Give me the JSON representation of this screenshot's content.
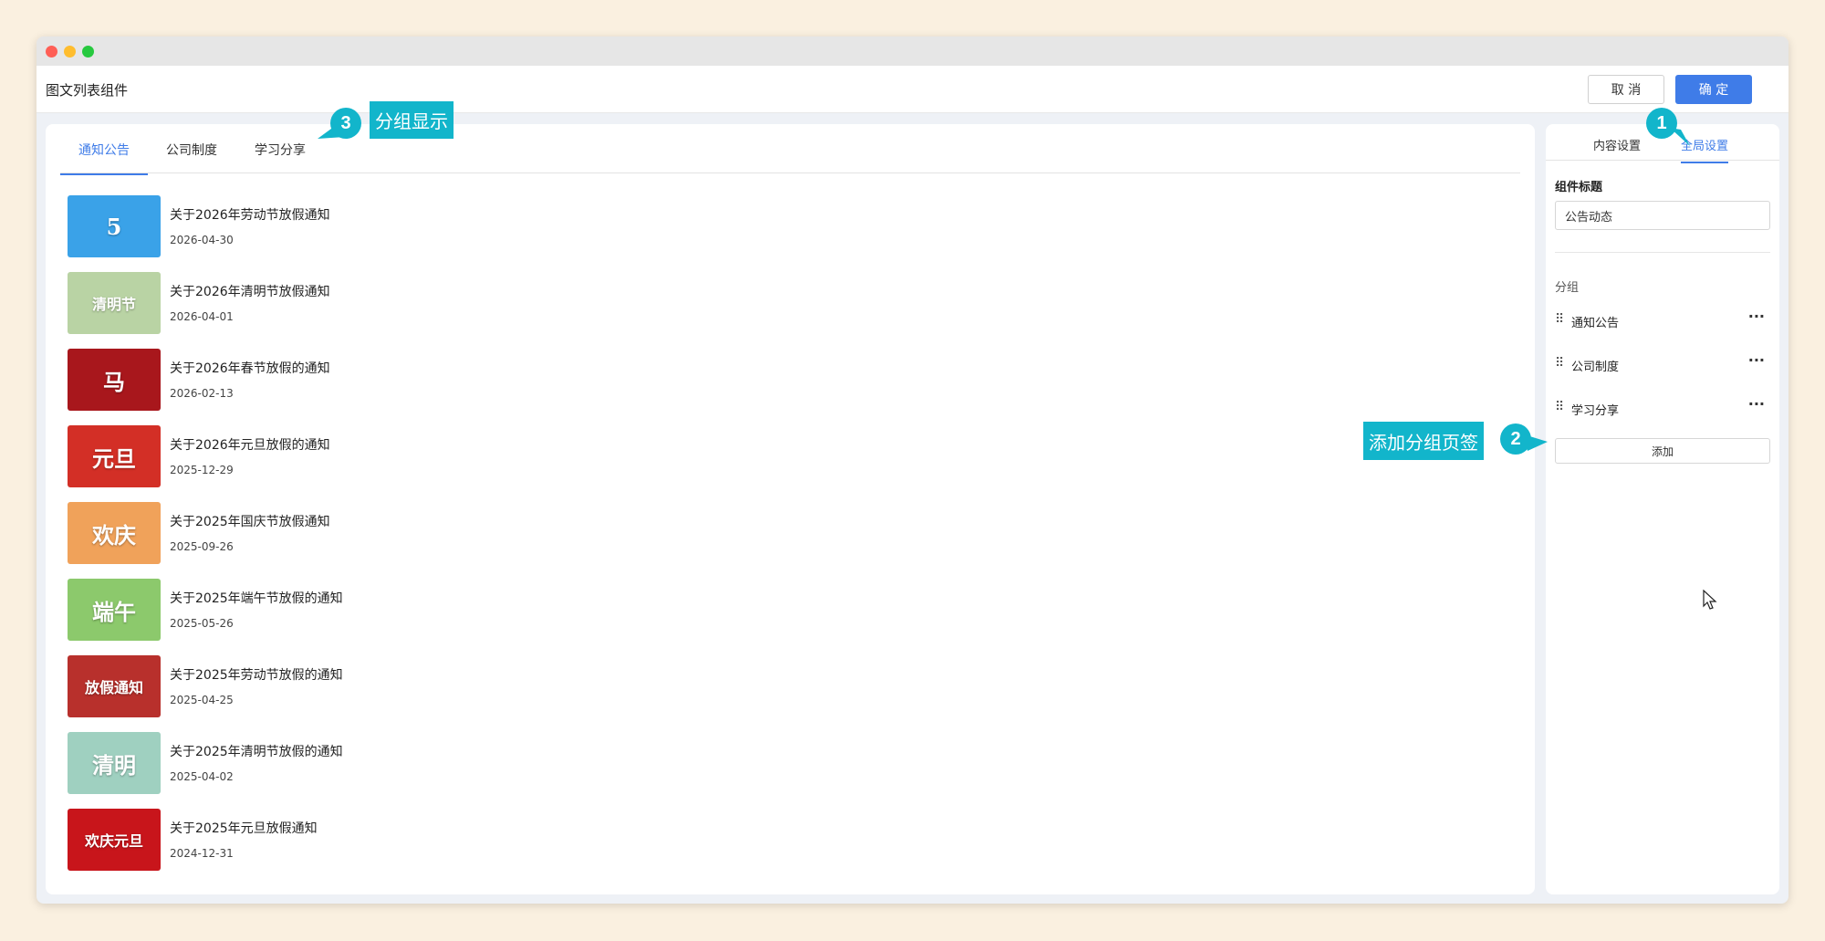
{
  "header": {
    "title": "图文列表组件",
    "cancel_label": "取 消",
    "ok_label": "确 定"
  },
  "tabs": [
    {
      "label": "通知公告",
      "active": true
    },
    {
      "label": "公司制度",
      "active": false
    },
    {
      "label": "学习分享",
      "active": false
    }
  ],
  "articles": [
    {
      "title": "关于2026年劳动节放假通知",
      "date": "2026-04-30",
      "thumb_text": "5",
      "thumb_color": "#3aa2e8"
    },
    {
      "title": "关于2026年清明节放假通知",
      "date": "2026-04-01",
      "thumb_text": "清明节",
      "thumb_color": "#b9d3a4"
    },
    {
      "title": "关于2026年春节放假的通知",
      "date": "2026-02-13",
      "thumb_text": "马",
      "thumb_color": "#a8171c"
    },
    {
      "title": "关于2026年元旦放假的通知",
      "date": "2025-12-29",
      "thumb_text": "元旦",
      "thumb_color": "#d32f26"
    },
    {
      "title": "关于2025年国庆节放假通知",
      "date": "2025-09-26",
      "thumb_text": "欢庆",
      "thumb_color": "#f0a25a"
    },
    {
      "title": "关于2025年端午节放假的通知",
      "date": "2025-05-26",
      "thumb_text": "端午",
      "thumb_color": "#8cc96c"
    },
    {
      "title": "关于2025年劳动节放假的通知",
      "date": "2025-04-25",
      "thumb_text": "放假通知",
      "thumb_color": "#b8302c"
    },
    {
      "title": "关于2025年清明节放假的通知",
      "date": "2025-04-02",
      "thumb_text": "清明",
      "thumb_color": "#9fd0c0"
    },
    {
      "title": "关于2025年元旦放假通知",
      "date": "2024-12-31",
      "thumb_text": "欢庆元旦",
      "thumb_color": "#c8151b"
    }
  ],
  "side": {
    "tab_content": "内容设置",
    "tab_global": "全局设置",
    "field_label": "组件标题",
    "field_value": "公告动态",
    "group_label": "分组",
    "groups": [
      "通知公告",
      "公司制度",
      "学习分享"
    ],
    "more_glyph": "···",
    "add_label": "添加"
  },
  "callouts": {
    "c1_number": "1",
    "c2_number": "2",
    "c2_text": "添加分组页签",
    "c3_number": "3",
    "c3_text": "分组显示"
  },
  "accent_color": "#3f7ce8",
  "callout_color": "#12b5cb"
}
